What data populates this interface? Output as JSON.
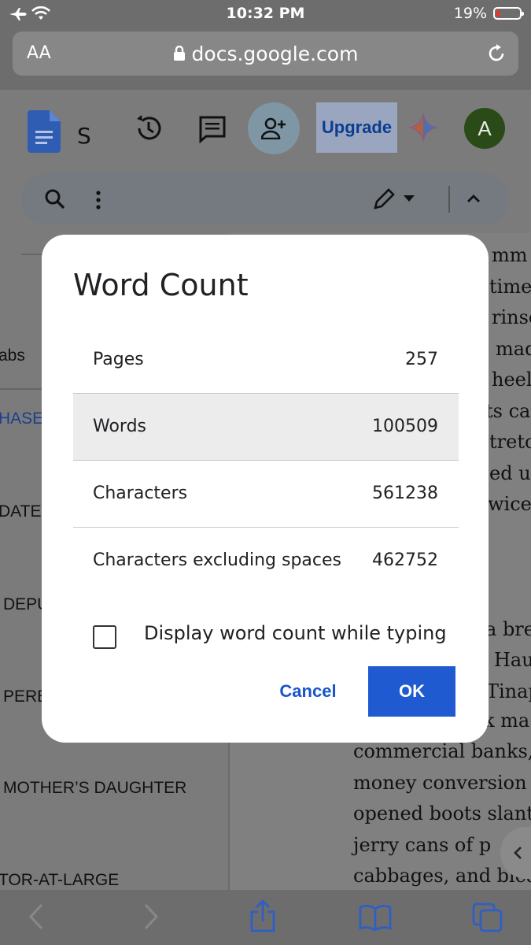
{
  "status": {
    "time": "10:32 PM",
    "battery_pct": "19%",
    "battery_level": 0.19
  },
  "browser": {
    "text_size_label": "AA",
    "domain": "docs.google.com"
  },
  "doc_toolbar": {
    "doc_initial": "S",
    "upgrade_label": "Upgrade",
    "avatar_letter": "A"
  },
  "sidebar": {
    "items": [
      "abs",
      "HASE",
      "DATE",
      "DEPU",
      "PERE",
      "MOTHER’S DAUGHTER",
      "TOR-AT-LARGE"
    ]
  },
  "page_text": {
    "lines": [
      "mm",
      "time",
      "rinse",
      "mad",
      "heel",
      "ts car",
      "tretc",
      "ed u",
      "wice.",
      "a bre",
      "Hau",
      "Tinap",
      "k ma",
      "commercial banks,",
      "money conversion",
      "opened boots slant",
      "jerry cans of p",
      "cabbages, and blea"
    ]
  },
  "dialog": {
    "title": "Word Count",
    "rows": [
      {
        "label": "Pages",
        "value": "257"
      },
      {
        "label": "Words",
        "value": "100509"
      },
      {
        "label": "Characters",
        "value": "561238"
      },
      {
        "label": "Characters excluding spaces",
        "value": "462752"
      }
    ],
    "checkbox_label": "Display word count while typing",
    "cancel_label": "Cancel",
    "ok_label": "OK"
  },
  "colors": {
    "accent": "#1f5ad1",
    "link": "#1a56c9",
    "overlay": "#7b7b7b"
  }
}
